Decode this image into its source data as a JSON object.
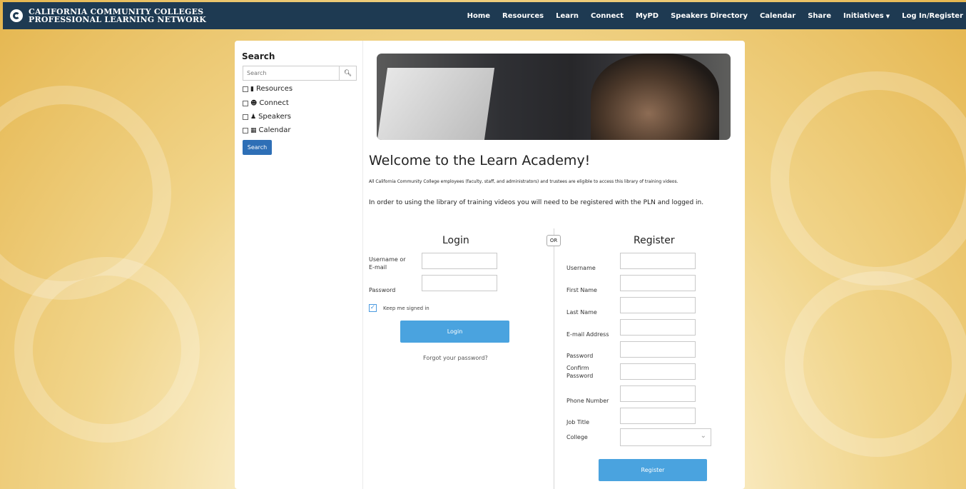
{
  "brand": {
    "line1": "CALIFORNIA COMMUNITY COLLEGES",
    "line2": "PROFESSIONAL LEARNING NETWORK"
  },
  "nav": {
    "home": "Home",
    "resources": "Resources",
    "learn": "Learn",
    "connect": "Connect",
    "mypd": "MyPD",
    "speakers": "Speakers Directory",
    "calendar": "Calendar",
    "share": "Share",
    "initiatives": "Initiatives",
    "login": "Log In/Register"
  },
  "sidebar": {
    "title": "Search",
    "placeholder": "Search",
    "filters": {
      "resources": "Resources",
      "connect": "Connect",
      "speakers": "Speakers",
      "calendar": "Calendar"
    },
    "button": "Search"
  },
  "main": {
    "title": "Welcome to the Learn Academy!",
    "intro_small": "All California Community College employees (faculty, staff, and administrators) and trustees are eligible to access this library of training videos.",
    "intro": "In order to using the library of training videos you will need to be registered with the PLN and logged in.",
    "or": "OR"
  },
  "login": {
    "title": "Login",
    "username_label": "Username or E-mail",
    "password_label": "Password",
    "keep_signed_in": "Keep me signed in",
    "button": "Login",
    "forgot": "Forgot your password?"
  },
  "register": {
    "title": "Register",
    "username": "Username",
    "first_name": "First Name",
    "last_name": "Last Name",
    "email": "E-mail Address",
    "password": "Password",
    "confirm_password": "Confirm Password",
    "phone": "Phone Number",
    "job_title": "Job Title",
    "college": "College",
    "button": "Register"
  }
}
